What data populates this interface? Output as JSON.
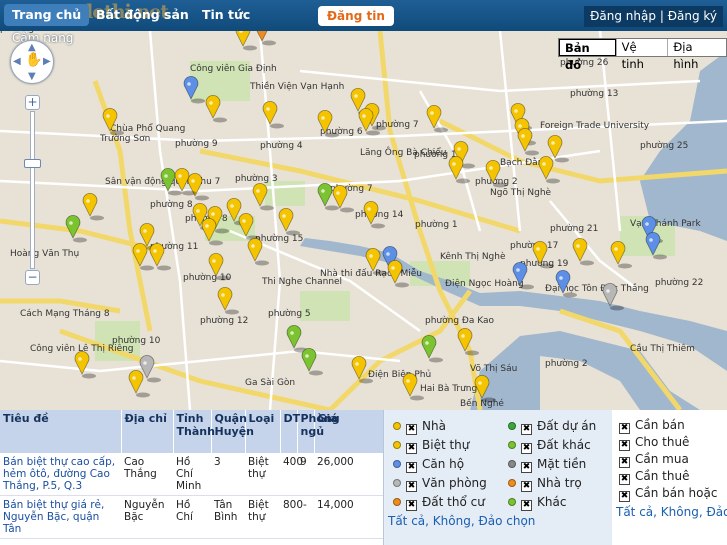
{
  "colors": {
    "nav_bg": "#14507f",
    "accent": "#e26a19",
    "pin_yellow": "#f5c400",
    "pin_blue": "#5d8fe6",
    "pin_green": "#7cc330",
    "pin_gray": "#b7b7b7",
    "pin_orange": "#f08c1e"
  },
  "nav": {
    "home": "Trang chủ",
    "realestate": "Bất động sản",
    "news": "Tin tức",
    "post": "Đăng tin",
    "login": "Đăng nhập",
    "separator": "|",
    "register": "Đăng ký",
    "guide": "Cẩm nang",
    "logo": "dothi.net"
  },
  "map": {
    "type_buttons": [
      "Bản đồ",
      "Vệ tinh",
      "Địa hình"
    ],
    "zoom_in": "+",
    "zoom_out": "−",
    "labels": [
      "Công viên Gia Định",
      "Thiền Viện Vạn Hạnh",
      "Chùa Phổ Quang",
      "phường 9",
      "phường 4",
      "phường 6",
      "phường 7",
      "phường 14",
      "phường 26",
      "phường 13",
      "phường 3",
      "phường 1",
      "phường 2",
      "phường 25",
      "Lăng Ông Bà Chiểu",
      "Sân vận động quân khu 7",
      "phường 8",
      "phường 15",
      "phường 17",
      "phường 11",
      "phường 21",
      "phường 19",
      "phường 22",
      "phường 12",
      "phường 5",
      "phường 10",
      "phường 2",
      "Thi Nghe Channel",
      "Nhà thi đấu Rạch Miễu",
      "Kênh Thị Nghè",
      "Điện Ngọc Hoàng",
      "phường Đa Kao",
      "Bến Nghé",
      "Đại học Tôn Đức Thắng",
      "Ga Sài Gòn",
      "Công viên Lê Thị Riêng",
      "Foreign Trade University",
      "Trường Sơn",
      "Hoàng Văn Thụ",
      "Cách Mạng Tháng 8",
      "Điện Biên Phủ",
      "Hai Bà Trưng",
      "Võ Thị Sáu",
      "Cầu Thị Thiêm",
      "Vạn Thánh Park",
      "Bạch Đằng",
      "Ngõ Thị Nghè",
      "phường 7",
      "phường 10",
      "phường 8",
      "phường 14",
      "phường 13"
    ],
    "pin_icon": "map-pin-icon"
  },
  "table": {
    "headers": [
      "Tiêu đề",
      "Địa chỉ",
      "Tỉnh Thành",
      "Quận Huyện",
      "Loại",
      "DT",
      "Phòng ngủ",
      "Giá"
    ],
    "rows": [
      {
        "title": "Bán biệt thự cao cấp, hẻm ôtô, đường Cao Thắng, P.5, Q.3",
        "address": "Cao Thắng",
        "province": "Hồ Chí Minh",
        "district": "3",
        "type": "Biệt thự",
        "area": "400",
        "beds": "9",
        "price": "26,000"
      },
      {
        "title": "Bán biệt thự giá rẻ, Nguyễn Bặc, quận Tân",
        "address": "Nguyễn Bặc",
        "province": "Hồ Chí",
        "district": "Tân Bình",
        "type": "Biệt thự",
        "area": "800-",
        "beds": "",
        "price": "14,000"
      }
    ]
  },
  "filters": {
    "types": [
      {
        "label": "Nhà",
        "color": "#f5c400"
      },
      {
        "label": "Biệt thự",
        "color": "#f5c400"
      },
      {
        "label": "Căn hộ",
        "color": "#5d8fe6"
      },
      {
        "label": "Văn phòng",
        "color": "#b7b7b7"
      },
      {
        "label": "Đất thổ cư",
        "color": "#f08c1e"
      },
      {
        "label": "Đất dự án",
        "color": "#3aa83a"
      },
      {
        "label": "Đất khác",
        "color": "#7cc330"
      },
      {
        "label": "Mặt tiền",
        "color": "#888888"
      },
      {
        "label": "Nhà trọ",
        "color": "#f08c1e"
      },
      {
        "label": "Khác",
        "color": "#7cc330"
      }
    ],
    "links": "Tất cả, Không, Đảo chọn",
    "status": [
      "Cần bán",
      "Cho thuê",
      "Cần mua",
      "Cần thuê",
      "Cần bán hoặc"
    ],
    "status_links": "Tất cả, Không, Đảo c",
    "check": "✖"
  }
}
